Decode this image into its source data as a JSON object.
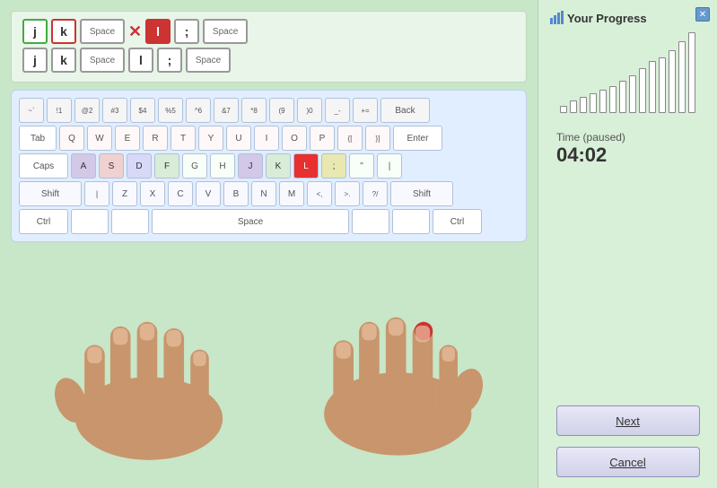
{
  "window": {
    "close_label": "✕"
  },
  "sidebar": {
    "title": "Your Progress",
    "time_label": "Time (paused)",
    "time_value": "04:02",
    "next_button": "Next",
    "cancel_button": "Cancel",
    "chart_bars": [
      8,
      14,
      18,
      22,
      26,
      30,
      36,
      42,
      50,
      58,
      62,
      70,
      80,
      90
    ]
  },
  "target": {
    "row1": [
      {
        "char": "j",
        "style": "green-border"
      },
      {
        "char": "k",
        "style": "red-border"
      },
      {
        "char": "Space",
        "style": "space-key"
      },
      {
        "char": "×",
        "style": "multiply"
      },
      {
        "char": "l",
        "style": "red-bg"
      },
      {
        "char": ";",
        "style": "normal"
      },
      {
        "char": "Space",
        "style": "space-key"
      }
    ],
    "row2": [
      {
        "char": "j",
        "style": "normal"
      },
      {
        "char": "k",
        "style": "normal"
      },
      {
        "char": "Space",
        "style": "space-key"
      },
      {
        "char": "l",
        "style": "normal"
      },
      {
        "char": ";",
        "style": "normal"
      },
      {
        "char": "Space",
        "style": "space-key"
      }
    ]
  },
  "keyboard": {
    "rows": [
      {
        "keys": [
          {
            "label": "~\n`",
            "style": "row-num"
          },
          {
            "label": "!\n1",
            "style": "row-num"
          },
          {
            "label": "@\n2",
            "style": "row-num"
          },
          {
            "label": "#\n3",
            "style": "row-num"
          },
          {
            "label": "$\n4",
            "style": "row-num"
          },
          {
            "label": "%\n5",
            "style": "row-num"
          },
          {
            "label": "^\n6",
            "style": "row-num"
          },
          {
            "label": "&\n7",
            "style": "row-num"
          },
          {
            "label": "*\n8",
            "style": "row-num"
          },
          {
            "label": "(\n9",
            "style": "row-num"
          },
          {
            "label": ")\n0",
            "style": "row-num"
          },
          {
            "label": "_\n-",
            "style": "row-num"
          },
          {
            "label": "+\n=",
            "style": "row-num"
          },
          {
            "label": "Back",
            "style": "wide-back row-num"
          }
        ]
      },
      {
        "keys": [
          {
            "label": "Tab",
            "style": "wide-1"
          },
          {
            "label": "Q",
            "style": "row-q"
          },
          {
            "label": "W",
            "style": "row-q"
          },
          {
            "label": "E",
            "style": "row-q"
          },
          {
            "label": "R",
            "style": "row-q"
          },
          {
            "label": "T",
            "style": "row-q"
          },
          {
            "label": "Y",
            "style": "row-q"
          },
          {
            "label": "U",
            "style": "row-q"
          },
          {
            "label": "I",
            "style": "row-q"
          },
          {
            "label": "O",
            "style": "row-q"
          },
          {
            "label": "P",
            "style": "row-q"
          },
          {
            "label": "{\n[",
            "style": "row-q"
          },
          {
            "label": "}\n]",
            "style": "row-q"
          },
          {
            "label": "Enter",
            "style": "wide-enter row-q"
          }
        ]
      },
      {
        "keys": [
          {
            "label": "Caps",
            "style": "wide-caps row-a"
          },
          {
            "label": "A",
            "style": "highlight-a"
          },
          {
            "label": "S",
            "style": "highlight-s"
          },
          {
            "label": "D",
            "style": "highlight-d"
          },
          {
            "label": "F",
            "style": "highlight-f"
          },
          {
            "label": "G",
            "style": "row-a"
          },
          {
            "label": "H",
            "style": "row-a"
          },
          {
            "label": "J",
            "style": "highlight-j"
          },
          {
            "label": "K",
            "style": "highlight-k"
          },
          {
            "label": "L",
            "style": "highlight-l"
          },
          {
            "label": ";",
            "style": "highlight-semi"
          },
          {
            "label": "\"",
            "style": "row-a"
          },
          {
            "label": "|",
            "style": "row-a"
          }
        ]
      },
      {
        "keys": [
          {
            "label": "Shift",
            "style": "wide-shift row-z"
          },
          {
            "label": "|",
            "style": "row-z"
          },
          {
            "label": "Z",
            "style": "row-z"
          },
          {
            "label": "X",
            "style": "row-z"
          },
          {
            "label": "C",
            "style": "row-z"
          },
          {
            "label": "V",
            "style": "row-z"
          },
          {
            "label": "B",
            "style": "row-z"
          },
          {
            "label": "N",
            "style": "row-z"
          },
          {
            "label": "M",
            "style": "row-z"
          },
          {
            "label": "<\n,",
            "style": "row-z"
          },
          {
            "label": ">\n.",
            "style": "row-z"
          },
          {
            "label": "?\n/",
            "style": "row-z"
          },
          {
            "label": "Shift",
            "style": "wide-shift-r row-z"
          }
        ]
      },
      {
        "keys": [
          {
            "label": "Ctrl",
            "style": "wide-ctrl"
          },
          {
            "label": "",
            "style": "wide-1"
          },
          {
            "label": "",
            "style": "wide-1"
          },
          {
            "label": "Space",
            "style": "space-bar"
          },
          {
            "label": "",
            "style": "wide-1"
          },
          {
            "label": "",
            "style": "wide-1"
          },
          {
            "label": "Ctrl",
            "style": "wide-ctrl"
          }
        ]
      }
    ]
  }
}
